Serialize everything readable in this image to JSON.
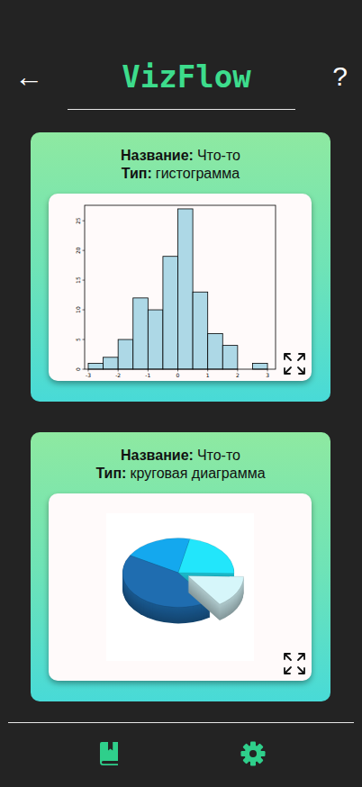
{
  "header": {
    "back": "←",
    "title": "VizFlow",
    "help": "?"
  },
  "cards": [
    {
      "kind": "histogram",
      "name_label": "Название:",
      "name": "Что-то",
      "type_label": "Тип:",
      "type": "гистограмма",
      "chart": {
        "x_range": [
          -3.12,
          3.27
        ],
        "y_range": [
          0,
          27.6
        ],
        "bin_start": -3,
        "bin_width": 0.5,
        "values": [
          1,
          2,
          5,
          12,
          10,
          19,
          27,
          13,
          6,
          4,
          0,
          1
        ],
        "x_ticks": [
          "-3",
          "-2",
          "-1",
          "0",
          "1",
          "2",
          "3"
        ],
        "y_ticks": [
          "0",
          "5",
          "10",
          "15",
          "20",
          "25"
        ]
      }
    },
    {
      "kind": "pie",
      "name_label": "Название:",
      "name": "Что-то",
      "type_label": "Тип:",
      "type": "круговая диаграмма",
      "chart": {
        "slices": [
          {
            "value": 20,
            "color": "#14a8ee",
            "exploded": false
          },
          {
            "value": 22,
            "color": "#22e6fb",
            "exploded": false
          },
          {
            "value": 15,
            "color": "#d6f6fa",
            "exploded": true
          },
          {
            "value": 43,
            "color": "#1f6db0",
            "exploded": false
          }
        ]
      }
    }
  ]
}
